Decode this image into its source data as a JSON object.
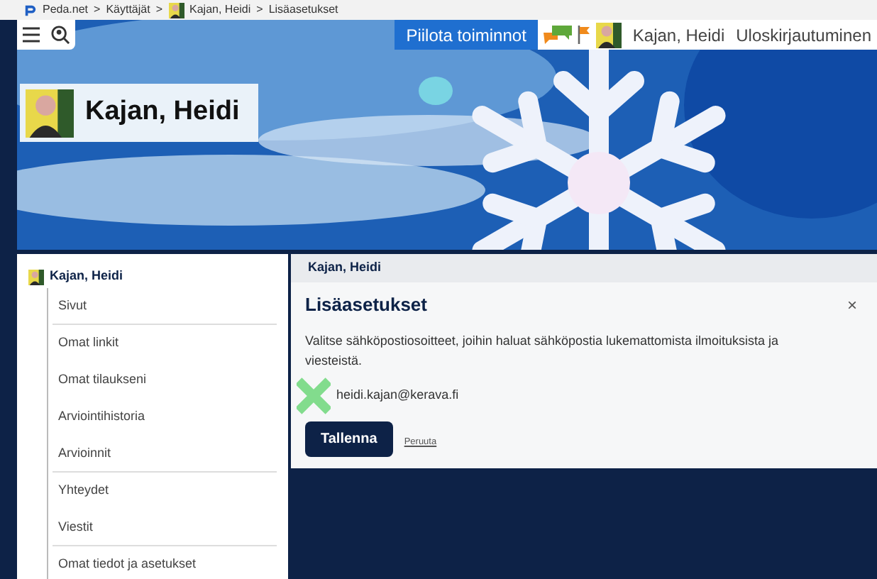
{
  "breadcrumb": [
    {
      "kind": "link",
      "label": "Peda.net"
    },
    {
      "kind": "sep",
      "label": ">"
    },
    {
      "kind": "link",
      "label": "Käyttäjät"
    },
    {
      "kind": "sep",
      "label": ">"
    },
    {
      "kind": "avatar-link",
      "label": "Kajan, Heidi"
    },
    {
      "kind": "sep",
      "label": ">"
    },
    {
      "kind": "current",
      "label": "Lisäasetukset"
    }
  ],
  "toolbar": {
    "hide_button": "Piilota toiminnot",
    "user": "Kajan, Heidi",
    "logout": "Uloskirjautuminen"
  },
  "banner": {
    "title": "Kajan, Heidi",
    "kind": "picture"
  },
  "sidebar": {
    "header": "Kajan, Heidi",
    "items": [
      {
        "label": "Sivut",
        "divider": true
      },
      {
        "label": "Omat linkit",
        "divider": false
      },
      {
        "label": "Omat tilaukseni",
        "divider": false
      },
      {
        "label": "Arviointihistoria",
        "divider": false
      },
      {
        "label": "Arvioinnit",
        "divider": true
      },
      {
        "label": "Yhteydet",
        "divider": false
      },
      {
        "label": "Viestit",
        "divider": true
      },
      {
        "label": "Omat tiedot ja asetukset"
      }
    ]
  },
  "panel": {
    "header": "Kajan, Heidi"
  },
  "dialog": {
    "title": "Lisäasetukset",
    "close": "×",
    "text": "Valitse sähköpostiosoitteet, joihin haluat sähköpostia lukemattomista ilmoituksista ja viesteistä.",
    "emails": [
      {
        "label": "heidi.kajan@kerava.fi",
        "marked": true
      }
    ],
    "save": "Tallenna",
    "cancel": "Peruuta"
  }
}
